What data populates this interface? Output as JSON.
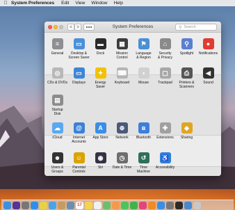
{
  "menubar": {
    "apple": "",
    "app": "System Preferences",
    "items": [
      "Edit",
      "View",
      "Window",
      "Help"
    ]
  },
  "window": {
    "title": "System Preferences",
    "search_placeholder": "Search",
    "back_glyph": "<",
    "forward_glyph": ">"
  },
  "rows": [
    [
      {
        "label": "General",
        "icon": "general-icon",
        "color": "#8e8e93",
        "glyph": "≡"
      },
      {
        "label": "Desktop &\nScreen Saver",
        "icon": "desktop-icon",
        "color": "#4a90d9",
        "glyph": "▭"
      },
      {
        "label": "Dock",
        "icon": "dock-icon",
        "color": "#2b2b2b",
        "glyph": "▬"
      },
      {
        "label": "Mission\nControl",
        "icon": "mission-control-icon",
        "color": "#3c3c3c",
        "glyph": "▦"
      },
      {
        "label": "Language\n& Region",
        "icon": "language-region-icon",
        "color": "#4b8fd6",
        "glyph": "⚑"
      },
      {
        "label": "Security\n& Privacy",
        "icon": "security-icon",
        "color": "#8a8a8a",
        "glyph": "⌂"
      },
      {
        "label": "Spotlight",
        "icon": "spotlight-icon",
        "color": "#5b7fd0",
        "glyph": "⚲"
      },
      {
        "label": "Notifications",
        "icon": "notifications-icon",
        "color": "#e23a2f",
        "glyph": "●"
      }
    ],
    [
      {
        "label": "CDs & DVDs",
        "icon": "cd-dvd-icon",
        "color": "#b8b8b8",
        "glyph": "◎"
      },
      {
        "label": "Displays",
        "icon": "displays-icon",
        "color": "#3d86d8",
        "glyph": "▭"
      },
      {
        "label": "Energy\nSaver",
        "icon": "energy-saver-icon",
        "color": "#f2c200",
        "glyph": "✦"
      },
      {
        "label": "Keyboard",
        "icon": "keyboard-icon",
        "color": "#b5b5b5",
        "glyph": "⌨"
      },
      {
        "label": "Mouse",
        "icon": "mouse-icon",
        "color": "#d0d0d0",
        "glyph": "◖"
      },
      {
        "label": "Trackpad",
        "icon": "trackpad-icon",
        "color": "#a8a8a8",
        "glyph": "▢"
      },
      {
        "label": "Printers &\nScanners",
        "icon": "printer-icon",
        "color": "#555555",
        "glyph": "⎙"
      },
      {
        "label": "Sound",
        "icon": "sound-icon",
        "color": "#333333",
        "glyph": "◀"
      }
    ],
    [
      {
        "label": "Startup\nDisk",
        "icon": "startup-disk-icon",
        "color": "#8c8c8c",
        "glyph": "▤"
      }
    ],
    [
      {
        "label": "iCloud",
        "icon": "icloud-icon",
        "color": "#5aa9ef",
        "glyph": "☁"
      },
      {
        "label": "Internet\nAccounts",
        "icon": "internet-accounts-icon",
        "color": "#3b82d6",
        "glyph": "@"
      },
      {
        "label": "App Store",
        "icon": "app-store-icon",
        "color": "#3a8ee6",
        "glyph": "A"
      },
      {
        "label": "Network",
        "icon": "network-icon",
        "color": "#4a5a78",
        "glyph": "⊕"
      },
      {
        "label": "Bluetooth",
        "icon": "bluetooth-icon",
        "color": "#3b7fdb",
        "glyph": "ʙ"
      },
      {
        "label": "Extensions",
        "icon": "extensions-icon",
        "color": "#a0a0a0",
        "glyph": "✚"
      },
      {
        "label": "Sharing",
        "icon": "sharing-icon",
        "color": "#e1a520",
        "glyph": "◆"
      }
    ],
    [
      {
        "label": "Users &\nGroups",
        "icon": "users-groups-icon",
        "color": "#333333",
        "glyph": "☻"
      },
      {
        "label": "Parental\nControls",
        "icon": "parental-controls-icon",
        "color": "#d9a300",
        "glyph": "☺"
      },
      {
        "label": "Siri",
        "icon": "siri-icon",
        "color": "#333344",
        "glyph": "◉"
      },
      {
        "label": "Date & Time",
        "icon": "date-time-icon",
        "color": "#6e6e6e",
        "glyph": "◷"
      },
      {
        "label": "Time\nMachine",
        "icon": "time-machine-icon",
        "color": "#2f6f5a",
        "glyph": "↺"
      },
      {
        "label": "Accessibility",
        "icon": "accessibility-icon",
        "color": "#2f7fd9",
        "glyph": "♿"
      }
    ]
  ],
  "dock": [
    {
      "icon": "finder-icon",
      "color": "#3d8fe0",
      "glyph": ""
    },
    {
      "icon": "siri-dock-icon",
      "color": "#553399",
      "glyph": ""
    },
    {
      "icon": "launchpad-icon",
      "color": "#777777",
      "glyph": ""
    },
    {
      "icon": "safari-icon",
      "color": "#2f8fe6",
      "glyph": ""
    },
    {
      "icon": "chrome-icon",
      "color": "#e8d14a",
      "glyph": ""
    },
    {
      "icon": "mail-icon",
      "color": "#4ba3e6",
      "glyph": ""
    },
    {
      "icon": "contacts-icon",
      "color": "#c79a62",
      "glyph": ""
    },
    {
      "icon": "preview-icon",
      "color": "#6a8fb0",
      "glyph": ""
    },
    {
      "icon": "calendar-icon",
      "color": "#ffffff",
      "glyph": "17"
    },
    {
      "icon": "notes-icon",
      "color": "#f4d44c",
      "glyph": ""
    },
    {
      "icon": "reminders-icon",
      "color": "#f0f0f0",
      "glyph": ""
    },
    {
      "icon": "maps-icon",
      "color": "#6cbf6a",
      "glyph": ""
    },
    {
      "icon": "photos-icon",
      "color": "#f29a4a",
      "glyph": ""
    },
    {
      "icon": "messages-icon",
      "color": "#4cc45a",
      "glyph": ""
    },
    {
      "icon": "facetime-icon",
      "color": "#3fb24f",
      "glyph": ""
    },
    {
      "icon": "itunes-icon",
      "color": "#e0457b",
      "glyph": ""
    },
    {
      "icon": "ibooks-icon",
      "color": "#f08a24",
      "glyph": ""
    },
    {
      "icon": "app-store-dock-icon",
      "color": "#3a8ee6",
      "glyph": ""
    },
    {
      "icon": "system-preferences-dock-icon",
      "color": "#777777",
      "glyph": ""
    },
    {
      "icon": "terminal-icon",
      "color": "#2a2a2a",
      "glyph": ""
    },
    {
      "icon": "downloads-icon",
      "color": "#4a88d0",
      "glyph": ""
    },
    {
      "icon": "trash-icon",
      "color": "#c8c8c8",
      "glyph": ""
    }
  ]
}
